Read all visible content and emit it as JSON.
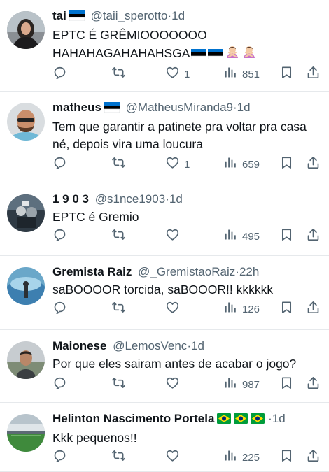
{
  "tweets": [
    {
      "name": "tai",
      "flags": [
        "estonia"
      ],
      "handle": "@taii_sperotto",
      "time": "1d",
      "text": "EPTC É GRÊMIOOOOOOO\nHAHAHAGAHAHAHSGA",
      "text_emojis": [
        "estonia-flag",
        "estonia-flag",
        "woman-gesturing-no",
        "woman-gesturing-no"
      ],
      "replies": "",
      "retweets": "",
      "likes": "1",
      "views": "851"
    },
    {
      "name": "matheus",
      "flags": [
        "estonia"
      ],
      "handle": "@MatheusMiranda9",
      "time": "1d",
      "text": "Tem que garantir a patinete pra voltar pra casa\nné, depois vira uma loucura",
      "text_emojis": [],
      "replies": "",
      "retweets": "",
      "likes": "1",
      "views": "659"
    },
    {
      "name": "1 9 0 3",
      "flags": [],
      "handle": "@s1nce1903",
      "time": "1d",
      "text": "EPTC é Gremio",
      "text_emojis": [],
      "replies": "",
      "retweets": "",
      "likes": "",
      "views": "495"
    },
    {
      "name": "Gremista Raiz",
      "flags": [],
      "handle": "@_GremistaoRaiz",
      "time": "22h",
      "text": "saBOOOOR torcida, saBOOOR!! kkkkkk",
      "text_emojis": [],
      "replies": "",
      "retweets": "",
      "likes": "",
      "views": "126"
    },
    {
      "name": "Maionese",
      "flags": [],
      "handle": "@LemosVenc",
      "time": "1d",
      "text": "Por que eles sairam antes de acabar o jogo?",
      "text_emojis": [],
      "replies": "",
      "retweets": "",
      "likes": "",
      "views": "987"
    },
    {
      "name": "Helinton Nascimento Portela",
      "flags": [
        "brazil",
        "brazil",
        "brazil"
      ],
      "handle": "",
      "time": "1d",
      "text": "Kkk pequenos!!",
      "text_emojis": [],
      "replies": "",
      "retweets": "",
      "likes": "",
      "views": "225"
    }
  ],
  "separator": "·",
  "colors": {
    "text": "#0f1419",
    "secondary": "#536471",
    "divider": "#e6e9ec",
    "estonia": [
      "#0072ce",
      "#000000",
      "#ffffff"
    ],
    "brazil": [
      "#009c3b",
      "#ffdf00",
      "#002776"
    ]
  },
  "icons": [
    "reply-icon",
    "retweet-icon",
    "like-icon",
    "views-icon",
    "bookmark-icon",
    "share-icon"
  ]
}
